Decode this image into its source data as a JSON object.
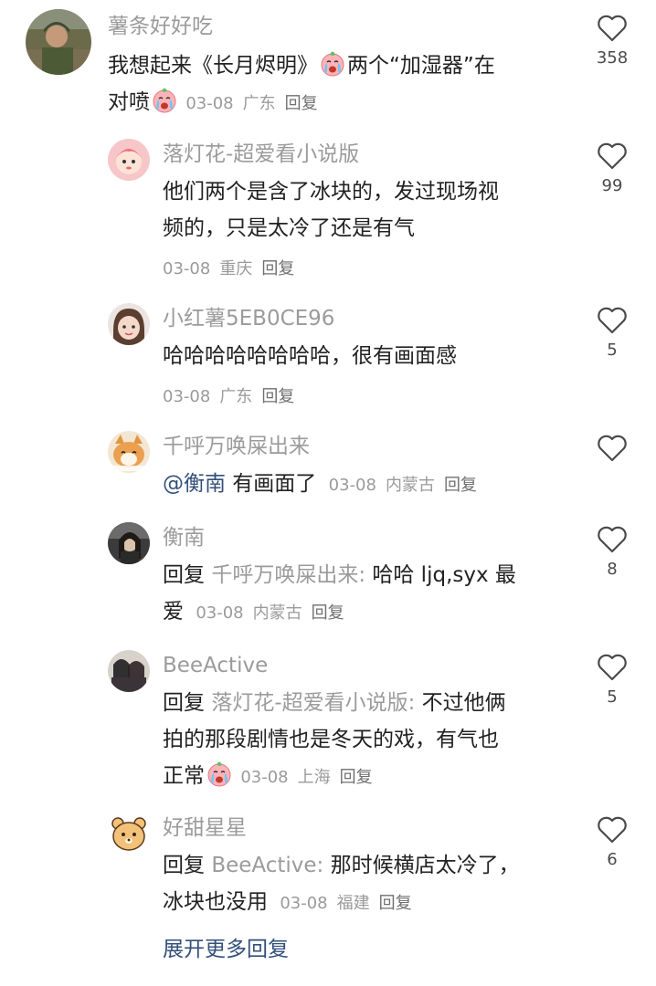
{
  "comments": [
    {
      "name": "薯条好好吃",
      "line1a": "我想起来《长月烬明》",
      "line1b": "两个“加湿器”在",
      "line2": "对喷",
      "date": "03-08",
      "location": "广东",
      "reply": "回复",
      "likes": "358",
      "avatar_icon": "soldier-avatar"
    },
    {
      "name": "落灯花-超爱看小说版",
      "line1": "他们两个是含了冰块的，发过现场视",
      "line2": "频的，只是太冷了还是有气",
      "date": "03-08",
      "location": "重庆",
      "reply": "回复",
      "likes": "99",
      "avatar_icon": "pink-cartoon-avatar"
    },
    {
      "name": "小红薯5EB0CE96",
      "line1": "哈哈哈哈哈哈哈哈，很有画面感",
      "date": "03-08",
      "location": "广东",
      "reply": "回复",
      "likes": "5",
      "avatar_icon": "child-avatar"
    },
    {
      "name": "千呼万唤屎出来",
      "mention": "@衡南",
      "line1": " 有画面了",
      "date": "03-08",
      "location": "内蒙古",
      "reply": "回复",
      "likes": "",
      "avatar_icon": "cat-avatar"
    },
    {
      "name": "衡南",
      "reply_prefix": "回复",
      "quoted": "千呼万唤屎出来:",
      "line1": " 哈哈 ljq,syx 最",
      "line2": "爱",
      "date": "03-08",
      "location": "内蒙古",
      "reply": "回复",
      "likes": "8",
      "avatar_icon": "dark-photo-avatar"
    },
    {
      "name": "BeeActive",
      "reply_prefix": "回复",
      "quoted": "落灯花-超爱看小说版:",
      "line1": " 不过他俩",
      "line2": "拍的那段剧情也是冬天的戏，有气也",
      "line3": "正常",
      "date": "03-08",
      "location": "上海",
      "reply": "回复",
      "likes": "5",
      "avatar_icon": "group-photo-avatar"
    },
    {
      "name": "好甜星星",
      "reply_prefix": "回复",
      "quoted": "BeeActive:",
      "line1": " 那时候横店太冷了，",
      "line2": "冰块也没用",
      "date": "03-08",
      "location": "福建",
      "reply": "回复",
      "likes": "6",
      "avatar_icon": "bear-cartoon-avatar"
    }
  ],
  "expand_label": "展开更多回复",
  "emoji_name": "crying-face-emoji",
  "colors": {
    "name_gray": "#9b9b9b",
    "text": "#222222",
    "link_blue": "#33507a",
    "heart_stroke": "#4a4a4a"
  }
}
